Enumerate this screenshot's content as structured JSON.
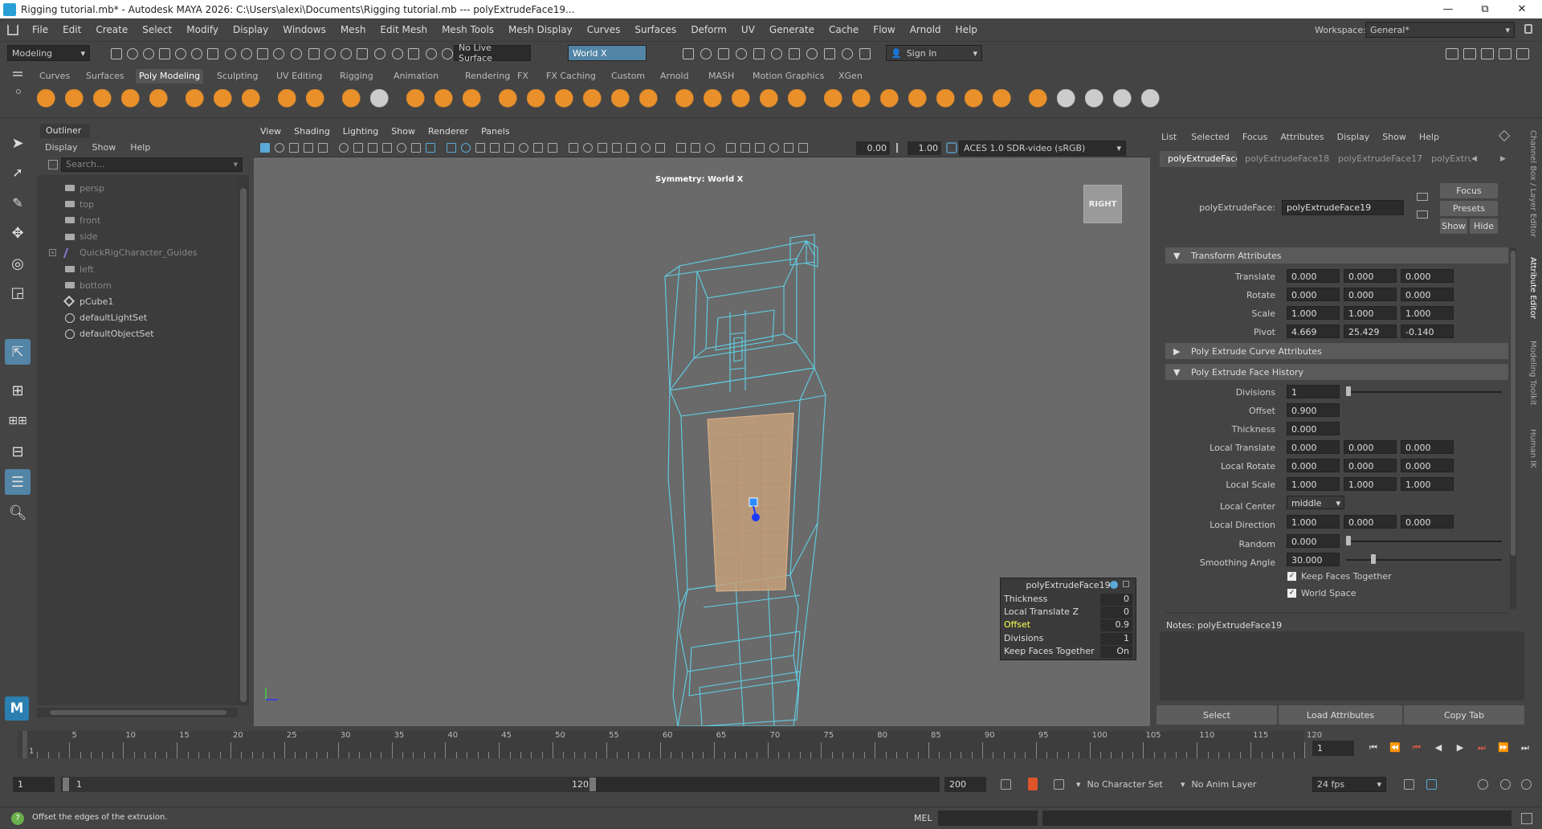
{
  "title_bar": {
    "title": "Rigging tutorial.mb* - Autodesk MAYA 2026: C:\\Users\\alexi\\Documents\\Rigging tutorial.mb  ---  polyExtrudeFace19...",
    "minimize": "—",
    "maximize": "⧉",
    "close": "✕"
  },
  "menu": {
    "items": [
      "File",
      "Edit",
      "Create",
      "Select",
      "Modify",
      "Display",
      "Windows",
      "Mesh",
      "Edit Mesh",
      "Mesh Tools",
      "Mesh Display",
      "Curves",
      "Surfaces",
      "Deform",
      "UV",
      "Generate",
      "Cache",
      "Flow",
      "Arnold",
      "Help"
    ],
    "workspace_label": "Workspace:",
    "workspace_value": "General*"
  },
  "status_line": {
    "mode": "Modeling",
    "live_surface": "No Live Surface",
    "symmetry": "World X",
    "sign_in": "Sign In"
  },
  "shelf": {
    "tabs": [
      "Curves",
      "Surfaces",
      "Poly Modeling",
      "Sculpting",
      "UV Editing",
      "Rigging",
      "Animation",
      "Rendering",
      "FX",
      "FX Caching",
      "Custom",
      "Arnold",
      "MASH",
      "Motion Graphics",
      "XGen"
    ],
    "active_tab": "Poly Modeling"
  },
  "outliner": {
    "title": "Outliner",
    "menu": [
      "Display",
      "Show",
      "Help"
    ],
    "search_placeholder": "Search...",
    "items": [
      {
        "label": "persp",
        "dim": true,
        "icon": "camera-icon"
      },
      {
        "label": "top",
        "dim": true,
        "icon": "camera-icon"
      },
      {
        "label": "front",
        "dim": true,
        "icon": "camera-icon"
      },
      {
        "label": "side",
        "dim": true,
        "icon": "camera-icon"
      },
      {
        "label": "QuickRigCharacter_Guides",
        "dim": true,
        "icon": "joint-icon"
      },
      {
        "label": "left",
        "dim": true,
        "icon": "camera-icon"
      },
      {
        "label": "bottom",
        "dim": true,
        "icon": "camera-icon"
      },
      {
        "label": "pCube1",
        "dim": false,
        "icon": "mesh-icon"
      },
      {
        "label": "defaultLightSet",
        "dim": false,
        "icon": "set-icon"
      },
      {
        "label": "defaultObjectSet",
        "dim": false,
        "icon": "set-icon"
      }
    ]
  },
  "viewport": {
    "menu": [
      "View",
      "Shading",
      "Lighting",
      "Show",
      "Renderer",
      "Panels"
    ],
    "exposure": "0.00",
    "gamma": "1.00",
    "color_space": "ACES 1.0 SDR-video (sRGB)",
    "symmetry_label": "Symmetry: World X",
    "view_cube": "RIGHT"
  },
  "hud": {
    "title": "polyExtrudeFace19",
    "rows": [
      {
        "label": "Thickness",
        "value": "0",
        "highlight": false
      },
      {
        "label": "Local Translate Z",
        "value": "0",
        "highlight": false
      },
      {
        "label": "Offset",
        "value": "0.9",
        "highlight": true
      },
      {
        "label": "Divisions",
        "value": "1",
        "highlight": false
      },
      {
        "label": "Keep Faces Together",
        "value": "On",
        "highlight": false
      }
    ]
  },
  "attribute_editor": {
    "menu": [
      "List",
      "Selected",
      "Focus",
      "Attributes",
      "Display",
      "Show",
      "Help"
    ],
    "tabs": [
      "polyExtrudeFace19",
      "polyExtrudeFace18",
      "polyExtrudeFace17",
      "polyExtru"
    ],
    "node_label": "polyExtrudeFace:",
    "node_value": "polyExtrudeFace19",
    "focus": "Focus",
    "presets": "Presets",
    "show": "Show",
    "hide": "Hide",
    "sections": {
      "transform": "Transform Attributes",
      "curve": "Poly Extrude Curve Attributes",
      "history": "Poly Extrude Face History"
    },
    "transform_rows": [
      {
        "label": "Translate",
        "values": [
          "0.000",
          "0.000",
          "0.000"
        ]
      },
      {
        "label": "Rotate",
        "values": [
          "0.000",
          "0.000",
          "0.000"
        ]
      },
      {
        "label": "Scale",
        "values": [
          "1.000",
          "1.000",
          "1.000"
        ]
      },
      {
        "label": "Pivot",
        "values": [
          "4.669",
          "25.429",
          "-0.140"
        ]
      }
    ],
    "history_rows": [
      {
        "label": "Divisions",
        "values": [
          "1"
        ],
        "slider": true
      },
      {
        "label": "Offset",
        "values": [
          "0.900"
        ],
        "slider": false
      },
      {
        "label": "Thickness",
        "values": [
          "0.000"
        ],
        "slider": false
      },
      {
        "label": "Local Translate",
        "values": [
          "0.000",
          "0.000",
          "0.000"
        ],
        "slider": false
      },
      {
        "label": "Local Rotate",
        "values": [
          "0.000",
          "0.000",
          "0.000"
        ],
        "slider": false
      },
      {
        "label": "Local Scale",
        "values": [
          "1.000",
          "1.000",
          "1.000"
        ],
        "slider": false
      }
    ],
    "local_center_label": "Local Center",
    "local_center_value": "middle",
    "local_direction_label": "Local Direction",
    "local_direction_values": [
      "1.000",
      "0.000",
      "0.000"
    ],
    "random_label": "Random",
    "random_value": "0.000",
    "smoothing_label": "Smoothing Angle",
    "smoothing_value": "30.000",
    "keep_faces": "Keep Faces Together",
    "world_space": "World Space",
    "notes_label": "Notes:  polyExtrudeFace19",
    "buttons": [
      "Select",
      "Load Attributes",
      "Copy Tab"
    ],
    "side_tabs": [
      "Channel Box / Layer Editor",
      "Attribute Editor",
      "Modeling Toolkit",
      "Human IK"
    ]
  },
  "timeline": {
    "ticks": [
      "1",
      "5",
      "10",
      "15",
      "20",
      "25",
      "30",
      "35",
      "40",
      "45",
      "50",
      "55",
      "60",
      "65",
      "70",
      "75",
      "80",
      "85",
      "90",
      "95",
      "100",
      "105",
      "110",
      "115",
      "120"
    ],
    "current_frame": "1"
  },
  "range": {
    "start": "1",
    "inner_start": "1",
    "inner_end": "120",
    "end": "200",
    "character_set": "No Character Set",
    "anim_layer": "No Anim Layer",
    "fps": "24 fps"
  },
  "help_line": {
    "text": "Offset the edges of the extrusion.",
    "mel": "MEL"
  },
  "colors": {
    "wire": "#5fd0e6",
    "face": "#c4a07a",
    "accent": "#5285a6",
    "highlight": "#ffff55"
  }
}
